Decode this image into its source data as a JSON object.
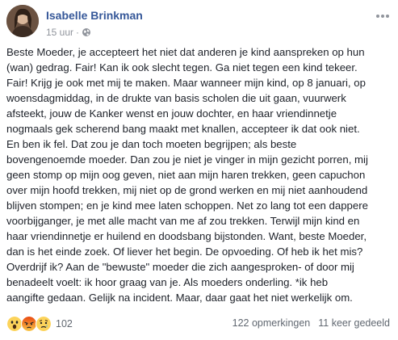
{
  "post": {
    "author": "Isabelle Brinkman",
    "time": "15 uur",
    "separator": "·",
    "audience_icon": "globe-icon",
    "more_icon": "more-options-icon",
    "text": "Beste Moeder, je accepteert het niet dat anderen je kind aanspreken op hun\n(wan) gedrag. Fair! Kan ik ook slecht tegen. Ga niet tegen een kind tekeer.\nFair! Krijg je ook met mij te maken. Maar wanneer mijn kind, op 8 januari, op\nwoensdagmiddag, in de drukte van basis scholen die uit gaan, vuurwerk\nafsteekt, jouw de Kanker wenst en jouw dochter, en haar vriendinnetje\nnogmaals gek scherend bang maakt met knallen, accepteer ik dat ook niet.\nEn ben ik fel. Dat zou je dan toch moeten begrijpen; als beste\nbovengenoemde moeder. Dan zou je niet je vinger in mijn gezicht porren, mij\ngeen stomp op mijn oog geven, niet aan mijn haren trekken, geen capuchon\nover mijn hoofd trekken, mij niet op de grond werken en mij niet aanhoudend\nblijven stompen; en je kind mee laten schoppen. Net zo lang tot een dappere\nvoorbijganger, je met alle macht van me af zou trekken. Terwijl mijn kind en\nhaar vriendinnetje er huilend en doodsbang bijstonden. Want, beste Moeder,\ndan is het einde zoek. Of liever het begin. De opvoeding. Of heb ik het mis?\nOverdrijf ik? Aan de \"bewuste\" moeder die zich aangesproken- of door mij\nbenadeelt voelt: ik hoor graag van je. Als moeders onderling. *ik heb\naangifte gedaan. Gelijk na incident. Maar, daar gaat het niet werkelijk om."
  },
  "footer": {
    "reactions": [
      "wow-reaction-icon",
      "angry-reaction-icon",
      "sad-reaction-icon"
    ],
    "reaction_count": "102",
    "comments": "122 opmerkingen",
    "shares": "11 keer gedeeld"
  },
  "colors": {
    "author_link": "#365899",
    "meta_gray": "#90949c",
    "text": "#1d2129",
    "reaction_yellow": "#fcd35a",
    "reaction_angry": "#e9710f"
  }
}
